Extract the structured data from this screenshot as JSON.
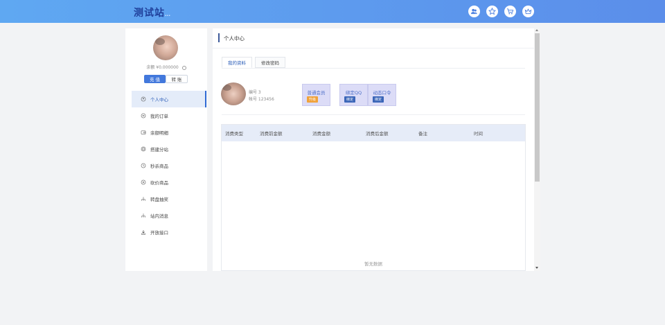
{
  "header": {
    "logo": "测试站",
    "logo_suffix": "...",
    "icons": [
      "user-group-icon",
      "favorite-icon",
      "cart-icon",
      "crown-icon"
    ]
  },
  "sidebar": {
    "balance": "余额 ¥0.000000",
    "refresh_icon": "refresh-icon",
    "recharge_label": "充 值",
    "transfer_label": "转 账",
    "items": [
      {
        "label": "个人中心",
        "icon": "user-center-icon",
        "active": true
      },
      {
        "label": "我的订单",
        "icon": "order-icon",
        "active": false
      },
      {
        "label": "余额明细",
        "icon": "wallet-icon",
        "active": false
      },
      {
        "label": "搭建分站",
        "icon": "substation-icon",
        "active": false
      },
      {
        "label": "秒杀商品",
        "icon": "flash-sale-icon",
        "active": false
      },
      {
        "label": "砍价商品",
        "icon": "bargain-icon",
        "active": false
      },
      {
        "label": "转盘抽奖",
        "icon": "lottery-icon",
        "active": false
      },
      {
        "label": "站内消息",
        "icon": "message-icon",
        "active": false
      },
      {
        "label": "开放接口",
        "icon": "api-download-icon",
        "active": false
      }
    ]
  },
  "main": {
    "title": "个人中心",
    "tabs": [
      {
        "label": "我的资料",
        "active": true
      },
      {
        "label": "修改密码",
        "active": false
      }
    ],
    "profile": {
      "id_line": "编号 3",
      "account_line": "帐号 123456"
    },
    "cards": [
      {
        "title": "普通会员",
        "badge": "升级",
        "badge_color": "#f0a23a"
      },
      {
        "title": "绑定QQ",
        "badge": "绑定",
        "badge_color": "#3b66b8"
      },
      {
        "title": "动态口令",
        "badge": "绑定",
        "badge_color": "#3b66b8"
      }
    ],
    "table": {
      "columns": [
        "消费类型",
        "消费前金额",
        "消费金额",
        "消费后金额",
        "备注",
        "时间"
      ],
      "empty_text": "暂无数据"
    }
  },
  "colors": {
    "header_gradient_start": "#5fa8f2",
    "header_gradient_end": "#5b8eea",
    "accent": "#4278dc",
    "active_menu_bg": "#e4ecf9"
  }
}
